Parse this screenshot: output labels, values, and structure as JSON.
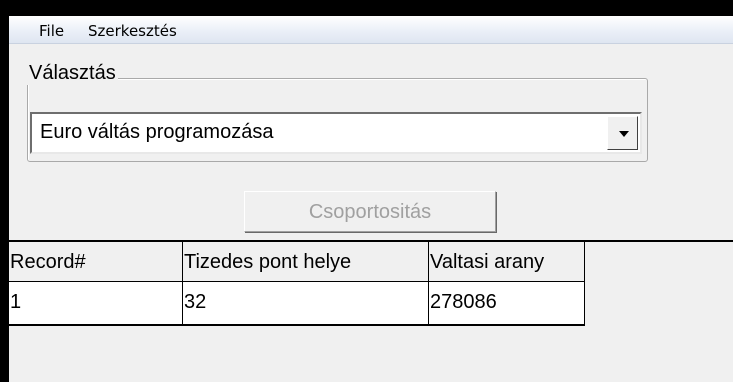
{
  "menu": {
    "items": [
      "File",
      "Szerkesztés"
    ]
  },
  "group": {
    "legend": "Választás",
    "combo_value": "Euro váltás programozása"
  },
  "buttons": {
    "group_by": "Csoportositás"
  },
  "grid": {
    "columns": [
      "Record#",
      "Tizedes pont helye",
      "Valtasi arany"
    ],
    "rows": [
      [
        "1",
        "32",
        "278086"
      ]
    ]
  }
}
